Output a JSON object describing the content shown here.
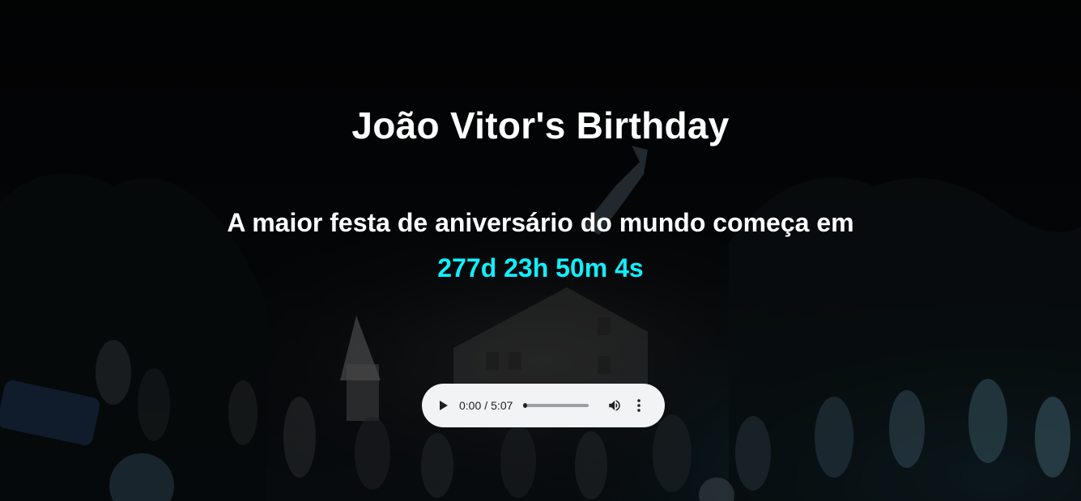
{
  "page": {
    "title": "João Vitor's Birthday",
    "subtitle": "A maior festa de aniversário do mundo começa em",
    "countdown": "277d 23h 50m 4s"
  },
  "audio_player": {
    "current_time": "0:00",
    "separator": "/",
    "duration": "5:07",
    "progress_fraction": 0,
    "icons": {
      "play": "play-icon",
      "volume": "volume-icon",
      "more": "more-vertical-icon"
    }
  },
  "colors": {
    "title": "#ffffff",
    "countdown": "#0ff0ff",
    "player_background": "#f1f3f4"
  }
}
